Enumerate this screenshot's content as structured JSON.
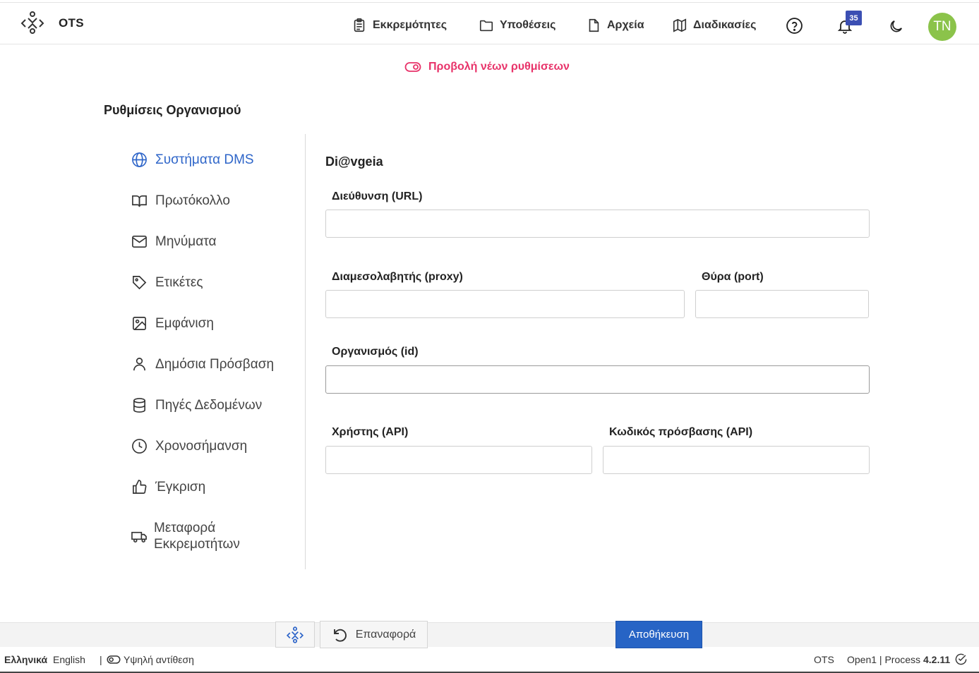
{
  "app": {
    "brand": "OTS"
  },
  "nav": {
    "items": [
      {
        "label": "Εκκρεμότητες",
        "icon": "clipboard-icon"
      },
      {
        "label": "Υποθέσεις",
        "icon": "folder-icon"
      },
      {
        "label": "Αρχεία",
        "icon": "file-icon"
      },
      {
        "label": "Διαδικασίες",
        "icon": "map-icon"
      }
    ],
    "notifications_count": "35",
    "avatar_initials": "TN"
  },
  "toggle": {
    "label": "Προβολή νέων ρυθμίσεων"
  },
  "page": {
    "title": "Ρυθμίσεις Οργανισμού"
  },
  "sidebar": {
    "items": [
      {
        "label": "Συστήματα DMS",
        "icon": "globe-icon",
        "active": true
      },
      {
        "label": "Πρωτόκολλο",
        "icon": "book-icon"
      },
      {
        "label": "Μηνύματα",
        "icon": "mail-icon"
      },
      {
        "label": "Ετικέτες",
        "icon": "tag-icon"
      },
      {
        "label": "Εμφάνιση",
        "icon": "image-icon"
      },
      {
        "label": "Δημόσια Πρόσβαση",
        "icon": "user-icon"
      },
      {
        "label": "Πηγές Δεδομένων",
        "icon": "database-icon"
      },
      {
        "label": "Χρονοσήμανση",
        "icon": "clock-icon"
      },
      {
        "label": "Έγκριση",
        "icon": "thumbs-up-icon"
      },
      {
        "label_line1": "Μεταφορά",
        "label_line2": "Εκκρεμοτήτων",
        "icon": "truck-icon"
      }
    ]
  },
  "form": {
    "title": "Di@vgeia",
    "url_label": "Διεύθυνση (URL)",
    "url_value": "",
    "proxy_label": "Διαμεσολαβητής (proxy)",
    "proxy_value": "",
    "port_label": "Θύρα (port)",
    "port_value": "",
    "org_label": "Οργανισμός (id)",
    "org_value": "",
    "user_label": "Χρήστης (API)",
    "user_value": "",
    "password_label": "Κωδικός πρόσβασης (API)",
    "password_value": ""
  },
  "actions": {
    "reset_label": "Επαναφορά",
    "save_label": "Αποθήκευση"
  },
  "footer": {
    "lang_el": "Ελληνικά",
    "lang_en": "English",
    "separator": "|",
    "high_contrast": "Υψηλή αντίθεση",
    "brand": "OTS",
    "product": "Open1 | Process",
    "version": "4.2.11"
  },
  "colors": {
    "accent": "#2f66c9",
    "toggle": "#e8336a",
    "save": "#2764c5",
    "badge": "#3b4fb3",
    "avatar": "#8bc34a"
  }
}
